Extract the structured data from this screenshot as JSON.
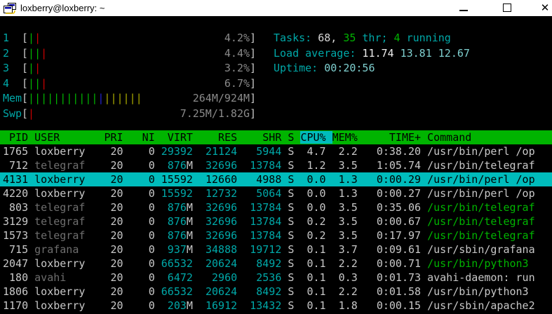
{
  "window": {
    "title": "loxberry@loxberry: ~",
    "controls": {
      "minimize": "minimize",
      "maximize": "maximize",
      "close": "✕"
    }
  },
  "meters": [
    {
      "id": "cpu1",
      "label": "1",
      "bars": "gr",
      "value": "4.2%"
    },
    {
      "id": "cpu2",
      "label": "2",
      "bars": "ggr",
      "value": "4.4%"
    },
    {
      "id": "cpu3",
      "label": "3",
      "bars": "gr",
      "value": "3.2%"
    },
    {
      "id": "cpu4",
      "label": "4",
      "bars": "ggr",
      "value": "6.7%"
    },
    {
      "id": "mem",
      "label": "Mem",
      "bars": "gggggggggggbyyyyyy",
      "value": "264M/924M"
    },
    {
      "id": "swp",
      "label": "Swp",
      "bars": "r",
      "value": "7.25M/1.82G"
    }
  ],
  "info": {
    "tasks_label": "Tasks:",
    "tasks_value": "68,",
    "threads_value": "35",
    "threads_label": "thr;",
    "running_value": "4",
    "running_label": "running",
    "load_label": "Load average:",
    "load_1min": "11.74",
    "load_5min": "13.81",
    "load_15min": "12.67",
    "uptime_label": "Uptime:",
    "uptime_value": "00:20:56"
  },
  "table": {
    "headers": [
      "PID",
      "USER",
      "PRI",
      "NI",
      "VIRT",
      "RES",
      "SHR",
      "S",
      "CPU%",
      "MEM%",
      "TIME+",
      "Command"
    ],
    "sort_column": "CPU%",
    "rows": [
      {
        "pid": "1765",
        "user": "loxberry",
        "pri": "20",
        "ni": "0",
        "virt": "29392",
        "res": "21124",
        "shr": "5944",
        "s": "S",
        "cpu": "4.7",
        "mem": "2.2",
        "time": "0:38.20",
        "command": "/usr/bin/perl /op",
        "user_dim": false,
        "command_green": false,
        "selected": false
      },
      {
        "pid": "712",
        "user": "telegraf",
        "pri": "20",
        "ni": "0",
        "virt": "876M",
        "res": "32696",
        "shr": "13784",
        "s": "S",
        "cpu": "1.2",
        "mem": "3.5",
        "time": "1:05.74",
        "command": "/usr/bin/telegraf",
        "user_dim": true,
        "command_green": false,
        "selected": false
      },
      {
        "pid": "4131",
        "user": "loxberry",
        "pri": "20",
        "ni": "0",
        "virt": "15592",
        "res": "12660",
        "shr": "4988",
        "s": "S",
        "cpu": "0.0",
        "mem": "1.3",
        "time": "0:00.29",
        "command": "/usr/bin/perl /op",
        "user_dim": false,
        "command_green": false,
        "selected": true
      },
      {
        "pid": "4220",
        "user": "loxberry",
        "pri": "20",
        "ni": "0",
        "virt": "15592",
        "res": "12732",
        "shr": "5064",
        "s": "S",
        "cpu": "0.0",
        "mem": "1.3",
        "time": "0:00.27",
        "command": "/usr/bin/perl /op",
        "user_dim": false,
        "command_green": false,
        "selected": false
      },
      {
        "pid": "803",
        "user": "telegraf",
        "pri": "20",
        "ni": "0",
        "virt": "876M",
        "res": "32696",
        "shr": "13784",
        "s": "S",
        "cpu": "0.0",
        "mem": "3.5",
        "time": "0:35.06",
        "command": "/usr/bin/telegraf",
        "user_dim": true,
        "command_green": true,
        "selected": false
      },
      {
        "pid": "3129",
        "user": "telegraf",
        "pri": "20",
        "ni": "0",
        "virt": "876M",
        "res": "32696",
        "shr": "13784",
        "s": "S",
        "cpu": "0.2",
        "mem": "3.5",
        "time": "0:00.67",
        "command": "/usr/bin/telegraf",
        "user_dim": true,
        "command_green": true,
        "selected": false
      },
      {
        "pid": "1573",
        "user": "telegraf",
        "pri": "20",
        "ni": "0",
        "virt": "876M",
        "res": "32696",
        "shr": "13784",
        "s": "S",
        "cpu": "0.2",
        "mem": "3.5",
        "time": "0:17.97",
        "command": "/usr/bin/telegraf",
        "user_dim": true,
        "command_green": true,
        "selected": false
      },
      {
        "pid": "715",
        "user": "grafana",
        "pri": "20",
        "ni": "0",
        "virt": "937M",
        "res": "34888",
        "shr": "19712",
        "s": "S",
        "cpu": "0.1",
        "mem": "3.7",
        "time": "0:09.61",
        "command": "/usr/sbin/grafana",
        "user_dim": true,
        "command_green": false,
        "selected": false
      },
      {
        "pid": "2047",
        "user": "loxberry",
        "pri": "20",
        "ni": "0",
        "virt": "66532",
        "res": "20624",
        "shr": "8492",
        "s": "S",
        "cpu": "0.1",
        "mem": "2.2",
        "time": "0:00.71",
        "command": "/usr/bin/python3",
        "user_dim": false,
        "command_green": true,
        "selected": false
      },
      {
        "pid": "180",
        "user": "avahi",
        "pri": "20",
        "ni": "0",
        "virt": "6472",
        "res": "2960",
        "shr": "2536",
        "s": "S",
        "cpu": "0.1",
        "mem": "0.3",
        "time": "0:01.73",
        "command": "avahi-daemon: run",
        "user_dim": true,
        "command_green": false,
        "selected": false
      },
      {
        "pid": "1806",
        "user": "loxberry",
        "pri": "20",
        "ni": "0",
        "virt": "66532",
        "res": "20624",
        "shr": "8492",
        "s": "S",
        "cpu": "0.1",
        "mem": "2.2",
        "time": "0:01.58",
        "command": "/usr/bin/python3",
        "user_dim": false,
        "command_green": false,
        "selected": false
      },
      {
        "pid": "1170",
        "user": "loxberry",
        "pri": "20",
        "ni": "0",
        "virt": "203M",
        "res": "16912",
        "shr": "13432",
        "s": "S",
        "cpu": "0.1",
        "mem": "1.8",
        "time": "0:00.15",
        "command": "/usr/sbin/apache2",
        "user_dim": false,
        "command_green": false,
        "selected": false
      }
    ]
  },
  "colors": {
    "background": "#000000",
    "titlebar_bg": "#ffffff",
    "text": "#c8c8c8",
    "cyan_label": "#00a8a8",
    "green": "#00b400",
    "red": "#c80000",
    "blue": "#2424d0",
    "yellow": "#a8a800",
    "gray_value": "#8a8a8a",
    "dim_user": "#6e6e6e",
    "pale_cyan": "#7fd0d0",
    "header_bg": "#00b400",
    "selection_bg": "#00bcbc"
  }
}
